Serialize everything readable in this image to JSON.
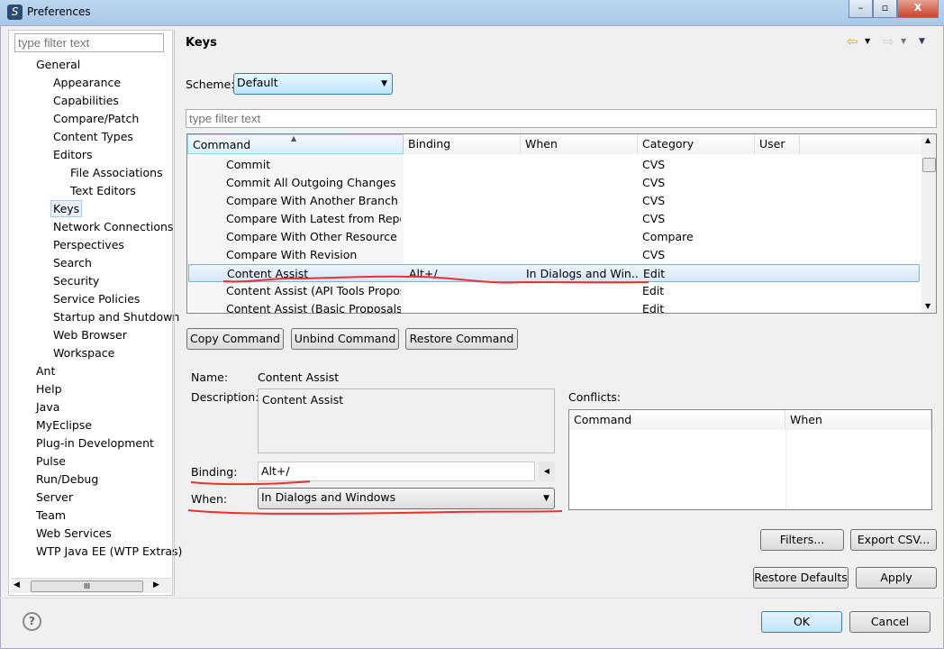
{
  "window": {
    "title": "Preferences",
    "icon": "eclipse-s-icon",
    "controls": [
      "minimize",
      "maximize",
      "close"
    ]
  },
  "sidebar": {
    "filter_placeholder": "type filter text",
    "items": [
      {
        "label": "General",
        "level": 0
      },
      {
        "label": "Appearance",
        "level": 1
      },
      {
        "label": "Capabilities",
        "level": 1
      },
      {
        "label": "Compare/Patch",
        "level": 1
      },
      {
        "label": "Content Types",
        "level": 1
      },
      {
        "label": "Editors",
        "level": 1
      },
      {
        "label": "File Associations",
        "level": 2
      },
      {
        "label": "Text Editors",
        "level": 2
      },
      {
        "label": "Keys",
        "level": 1,
        "selected": true
      },
      {
        "label": "Network Connections",
        "level": 1
      },
      {
        "label": "Perspectives",
        "level": 1
      },
      {
        "label": "Search",
        "level": 1
      },
      {
        "label": "Security",
        "level": 1
      },
      {
        "label": "Service Policies",
        "level": 1
      },
      {
        "label": "Startup and Shutdown",
        "level": 1
      },
      {
        "label": "Web Browser",
        "level": 1
      },
      {
        "label": "Workspace",
        "level": 1
      },
      {
        "label": "Ant",
        "level": 0
      },
      {
        "label": "Help",
        "level": 0
      },
      {
        "label": "Java",
        "level": 0
      },
      {
        "label": "MyEclipse",
        "level": 0
      },
      {
        "label": "Plug-in Development",
        "level": 0
      },
      {
        "label": "Pulse",
        "level": 0
      },
      {
        "label": "Run/Debug",
        "level": 0
      },
      {
        "label": "Server",
        "level": 0
      },
      {
        "label": "Team",
        "level": 0
      },
      {
        "label": "Web Services",
        "level": 0
      },
      {
        "label": "WTP Java EE (WTP Extras)",
        "level": 0
      }
    ],
    "scroll_grip": "III"
  },
  "page": {
    "title": "Keys",
    "nav": {
      "back": "back-arrow-icon",
      "forward": "forward-arrow-icon",
      "menu": "view-menu-icon"
    }
  },
  "scheme": {
    "label": "Scheme:",
    "value": "Default"
  },
  "filter_placeholder": "type filter text",
  "table": {
    "columns": [
      "Command",
      "Binding",
      "When",
      "Category",
      "User"
    ],
    "sort_indicator": "▲",
    "rows": [
      {
        "command": "Commit",
        "binding": "",
        "when": "",
        "category": "CVS",
        "user": ""
      },
      {
        "command": "Commit All Outgoing Changes",
        "binding": "",
        "when": "",
        "category": "CVS",
        "user": ""
      },
      {
        "command": "Compare With Another Branch or Version",
        "binding": "",
        "when": "",
        "category": "CVS",
        "user": ""
      },
      {
        "command": "Compare With Latest from Repository",
        "binding": "",
        "when": "",
        "category": "CVS",
        "user": ""
      },
      {
        "command": "Compare With Other Resource",
        "binding": "",
        "when": "",
        "category": "Compare",
        "user": ""
      },
      {
        "command": "Compare With Revision",
        "binding": "",
        "when": "",
        "category": "CVS",
        "user": ""
      },
      {
        "command": "Content Assist",
        "binding": "Alt+/",
        "when": "In Dialogs and Win...",
        "category": "Edit",
        "user": "",
        "selected": true
      },
      {
        "command": "Content Assist (API Tools Proposals)",
        "binding": "",
        "when": "",
        "category": "Edit",
        "user": ""
      },
      {
        "command": "Content Assist (Basic Proposals)",
        "binding": "",
        "when": "",
        "category": "Edit",
        "user": ""
      }
    ]
  },
  "buttons": {
    "copy": "Copy Command",
    "unbind": "Unbind Command",
    "restore": "Restore Command",
    "filters": "Filters...",
    "export": "Export CSV...",
    "restore_defaults": "Restore Defaults",
    "apply": "Apply",
    "ok": "OK",
    "cancel": "Cancel"
  },
  "details": {
    "name_label": "Name:",
    "name_value": "Content Assist",
    "description_label": "Description:",
    "description_value": "Content Assist",
    "binding_label": "Binding:",
    "binding_value": "Alt+/",
    "when_label": "When:",
    "when_value": "In Dialogs and Windows",
    "conflicts_label": "Conflicts:",
    "conflicts_columns": [
      "Command",
      "When"
    ]
  },
  "annotation_color": "#ff0000"
}
